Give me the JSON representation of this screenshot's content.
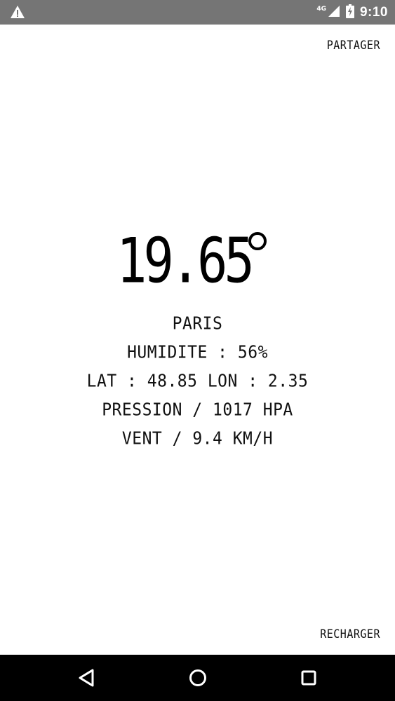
{
  "status_bar": {
    "network": "4G",
    "time": "9:10",
    "icons": [
      "warning-icon",
      "signal-icon",
      "battery-charging-icon"
    ]
  },
  "actions": {
    "share_label": "PARTAGER",
    "reload_label": "RECHARGER"
  },
  "weather": {
    "temperature": "19.65",
    "degree_symbol": "°",
    "city": "PARIS",
    "humidity": "HUMIDITE : 56%",
    "coordinates": "LAT : 48.85 LON : 2.35",
    "pressure": "PRESSION / 1017 HPA",
    "wind": "VENT / 9.4 KM/H"
  },
  "nav_bar": {
    "icons": [
      "back-icon",
      "home-icon",
      "recents-icon"
    ]
  },
  "colors": {
    "status_bar": "#757575",
    "nav_bar": "#000000",
    "background": "#ffffff",
    "text": "#111111"
  }
}
